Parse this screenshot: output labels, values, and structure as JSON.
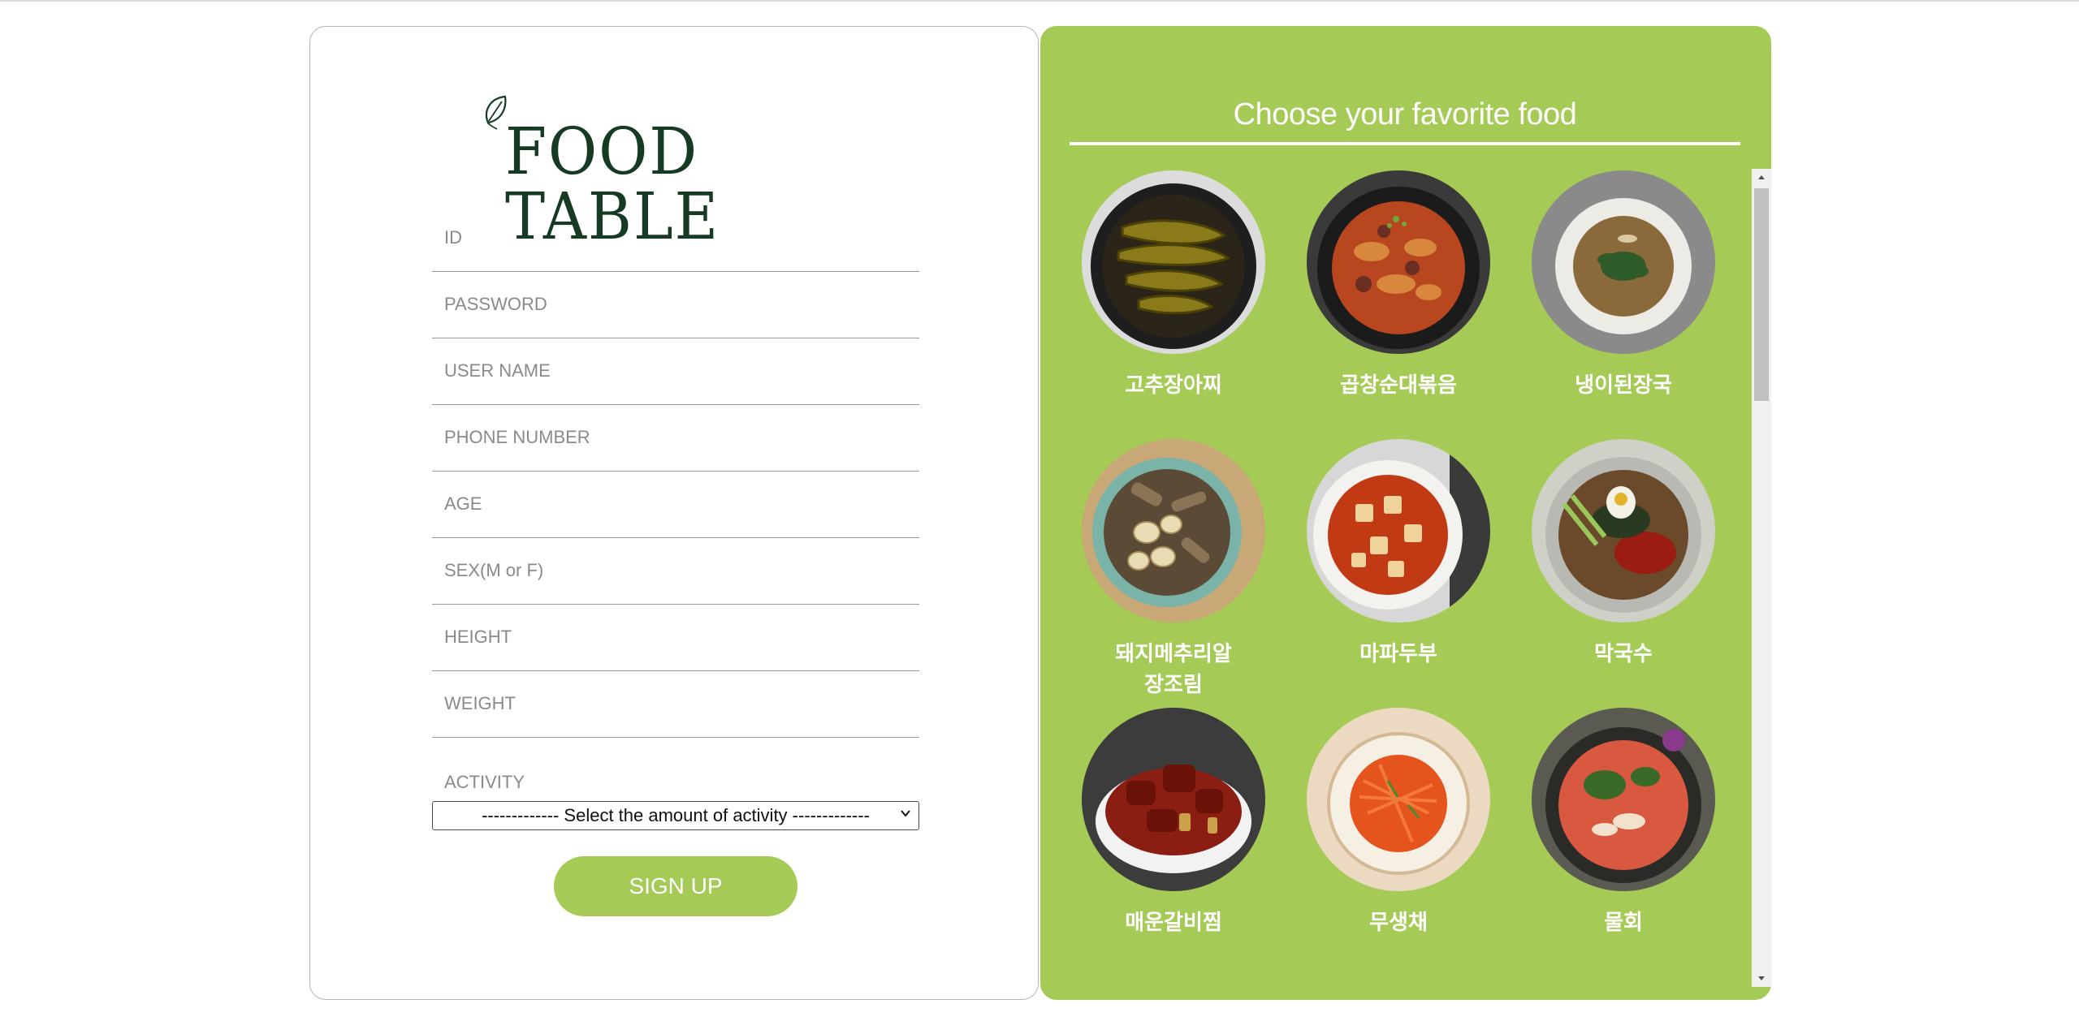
{
  "app": {
    "logo_text": "FOOD TABLE"
  },
  "form": {
    "fields": [
      {
        "placeholder": "ID",
        "value": ""
      },
      {
        "placeholder": "PASSWORD",
        "value": ""
      },
      {
        "placeholder": "USER NAME",
        "value": ""
      },
      {
        "placeholder": "PHONE NUMBER",
        "value": ""
      },
      {
        "placeholder": "AGE",
        "value": ""
      },
      {
        "placeholder": "SEX(M or F)",
        "value": ""
      },
      {
        "placeholder": "HEIGHT",
        "value": ""
      },
      {
        "placeholder": "WEIGHT",
        "value": ""
      }
    ],
    "activity_label": "ACTIVITY",
    "activity_select": "------------- Select the amount of activity -------------",
    "signup_label": "SIGN UP"
  },
  "food_panel": {
    "title": "Choose your favorite food",
    "items": [
      {
        "name": "고추장아찌",
        "icon": "pickled-pepper-dish"
      },
      {
        "name": "곱창순대볶음",
        "icon": "stir-fried-gopchang-dish"
      },
      {
        "name": "냉이된장국",
        "icon": "shepherds-purse-soup"
      },
      {
        "name": "돼지메추리알\n장조림",
        "icon": "braised-pork-quail-egg-dish"
      },
      {
        "name": "마파두부",
        "icon": "mapo-tofu-dish"
      },
      {
        "name": "막국수",
        "icon": "buckwheat-noodle-dish"
      },
      {
        "name": "매운갈비찜",
        "icon": "spicy-braised-ribs-dish"
      },
      {
        "name": "무생채",
        "icon": "radish-salad-dish"
      },
      {
        "name": "물회",
        "icon": "cold-raw-fish-soup"
      }
    ]
  },
  "colors": {
    "accent": "#a5cb56",
    "logo": "#163a24"
  }
}
